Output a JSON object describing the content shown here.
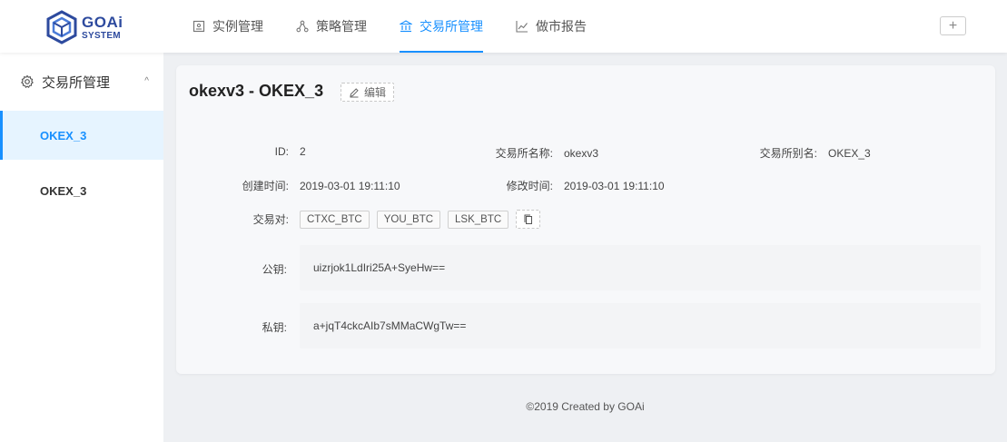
{
  "brand": {
    "line1": "GOAi",
    "line2": "SYSTEM",
    "color": "#2d4a9e"
  },
  "nav": [
    {
      "label": "实例管理",
      "icon": "instance-icon"
    },
    {
      "label": "策略管理",
      "icon": "strategy-icon"
    },
    {
      "label": "交易所管理",
      "icon": "exchange-icon",
      "active": true
    },
    {
      "label": "做市报告",
      "icon": "chart-line-icon"
    }
  ],
  "accent_color": "#1890ff",
  "header": {
    "add_label": "+"
  },
  "sidebar": {
    "group_label": "交易所管理",
    "items": [
      {
        "label": "OKEX_3",
        "active": true
      },
      {
        "label": "OKEX_3",
        "active": false
      }
    ]
  },
  "detail": {
    "title": "okexv3 - OKEX_3",
    "edit_label": "编辑",
    "fields": {
      "id_label": "ID:",
      "id_value": "2",
      "name_label": "交易所名称:",
      "name_value": "okexv3",
      "alias_label": "交易所别名:",
      "alias_value": "OKEX_3",
      "created_label": "创建时间:",
      "created_value": "2019-03-01 19:11:10",
      "modified_label": "修改时间:",
      "modified_value": "2019-03-01 19:11:10",
      "pairs_label": "交易对:",
      "pairs": [
        "CTXC_BTC",
        "YOU_BTC",
        "LSK_BTC"
      ],
      "public_key_label": "公钥:",
      "public_key_value": "uizrjok1LdIri25A+SyeHw==",
      "private_key_label": "私钥:",
      "private_key_value": "a+jqT4ckcAIb7sMMaCWgTw=="
    }
  },
  "footer": {
    "text": "©2019 Created by GOAi"
  }
}
